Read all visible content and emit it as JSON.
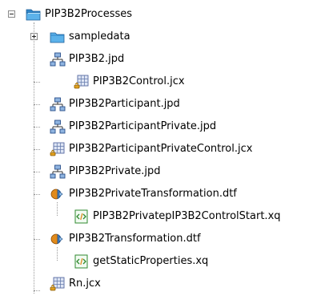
{
  "tree": {
    "root": {
      "label": "PIP3B2Processes",
      "icon": "folder-open-icon",
      "expanded": true
    },
    "items": [
      {
        "label": "sampledata",
        "icon": "folder-icon",
        "expandable": true,
        "expanded": false
      },
      {
        "label": "PIP3B2.jpd",
        "icon": "process-icon"
      },
      {
        "label": "PIP3B2Control.jcx",
        "icon": "control-icon"
      },
      {
        "label": "PIP3B2Participant.jpd",
        "icon": "process-icon"
      },
      {
        "label": "PIP3B2ParticipantPrivate.jpd",
        "icon": "process-icon"
      },
      {
        "label": "PIP3B2ParticipantPrivateControl.jcx",
        "icon": "control-icon"
      },
      {
        "label": "PIP3B2Private.jpd",
        "icon": "process-icon"
      },
      {
        "label": "PIP3B2PrivateTransformation.dtf",
        "icon": "transformation-icon"
      },
      {
        "label": "PIP3B2PrivatepIP3B2ControlStart.xq",
        "icon": "xquery-icon"
      },
      {
        "label": "PIP3B2Transformation.dtf",
        "icon": "transformation-icon"
      },
      {
        "label": "getStaticProperties.xq",
        "icon": "xquery-icon"
      },
      {
        "label": "Rn.jcx",
        "icon": "control-icon"
      }
    ]
  },
  "colors": {
    "folder": "#4aa3df",
    "folder_dark": "#1f6fa8",
    "control_orange": "#e0a020",
    "control_grid": "#6a7fae",
    "xquery_green": "#3a9a3a",
    "transform_orange": "#e08a1c",
    "transform_blue": "#4a86c8"
  }
}
